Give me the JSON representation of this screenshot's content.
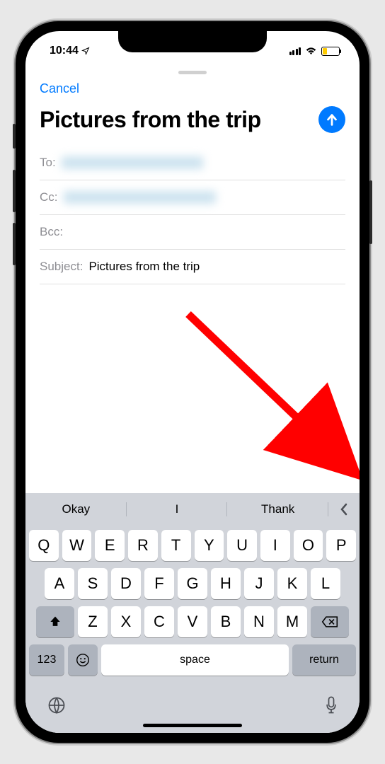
{
  "status": {
    "time": "10:44"
  },
  "header": {
    "cancel_label": "Cancel"
  },
  "compose": {
    "title": "Pictures from the trip",
    "to_label": "To:",
    "cc_label": "Cc:",
    "bcc_label": "Bcc:",
    "subject_label": "Subject:",
    "subject_value": "Pictures from the trip"
  },
  "keyboard": {
    "predictions": [
      "Okay",
      "I",
      "Thank"
    ],
    "row1": [
      "Q",
      "W",
      "E",
      "R",
      "T",
      "Y",
      "U",
      "I",
      "O",
      "P"
    ],
    "row2": [
      "A",
      "S",
      "D",
      "F",
      "G",
      "H",
      "J",
      "K",
      "L"
    ],
    "row3": [
      "Z",
      "X",
      "C",
      "V",
      "B",
      "N",
      "M"
    ],
    "numbers_label": "123",
    "space_label": "space",
    "return_label": "return"
  }
}
